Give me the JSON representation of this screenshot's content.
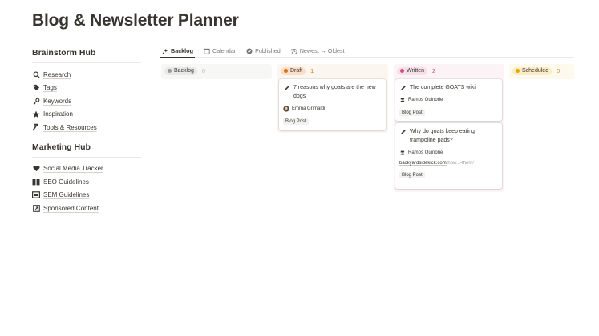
{
  "page": {
    "title": "Blog & Newsletter Planner"
  },
  "sidebar": {
    "brainstorm_hub": {
      "title": "Brainstorm Hub",
      "items": [
        {
          "label": "Research",
          "icon": "search-icon"
        },
        {
          "label": "Tags",
          "icon": "tag-icon"
        },
        {
          "label": "Keywords",
          "icon": "key-icon"
        },
        {
          "label": "Inspiration",
          "icon": "star-icon"
        },
        {
          "label": "Tools & Resources",
          "icon": "hammer-icon"
        }
      ]
    },
    "marketing_hub": {
      "title": "Marketing Hub",
      "items": [
        {
          "label": "Social Media Tracker",
          "icon": "heart-icon"
        },
        {
          "label": "SEO Guidelines",
          "icon": "book-icon"
        },
        {
          "label": "SEM Guidelines",
          "icon": "screen-icon"
        },
        {
          "label": "Sponsored Content",
          "icon": "external-link-icon"
        }
      ]
    }
  },
  "tabs": [
    {
      "label": "Backlog",
      "icon": "sparkle-icon",
      "active": true
    },
    {
      "label": "Calendar",
      "icon": "calendar-icon",
      "active": false
    },
    {
      "label": "Published",
      "icon": "check-circle-icon",
      "active": false
    },
    {
      "label": "Newest → Oldest",
      "icon": "history-icon",
      "active": false
    }
  ],
  "board": {
    "columns": [
      {
        "label": "Backlog",
        "count": "0",
        "dot": "#9b9a97",
        "pill_bg": "#e9e9e7",
        "col_bg": "#f7f7f5",
        "count_color": "#b4b4b0",
        "cards": []
      },
      {
        "label": "Draft",
        "count": "1",
        "dot": "#d9730d",
        "pill_bg": "#fadec9",
        "col_bg": "#fcf6f1",
        "count_color": "#d9730d",
        "cards": [
          {
            "title": "7 reasons why goats are the new dogs",
            "author": "Emma Grimaldi",
            "tag": "Blog Post"
          }
        ]
      },
      {
        "label": "Written",
        "count": "2",
        "dot": "#d44c82",
        "pill_bg": "#f5e0e9",
        "col_bg": "#fcf3f6",
        "count_color": "#c14c8a",
        "cards": [
          {
            "title": "The complete GOATS wiki",
            "author": "Ramos Quinorie",
            "tag": "Blog Post"
          },
          {
            "title": "Why do goats keep eating trampoline pads?",
            "author": "Ramos Quinorie",
            "link_domain": "backyardsidekick.com",
            "link_rest": "/how...-them/",
            "tag": "Blog Post"
          }
        ]
      },
      {
        "label": "Scheduled",
        "count": "0",
        "dot": "#dfab01",
        "pill_bg": "#fbecc8",
        "col_bg": "#fdf9ec",
        "count_color": "#c29343",
        "cards": []
      }
    ]
  }
}
